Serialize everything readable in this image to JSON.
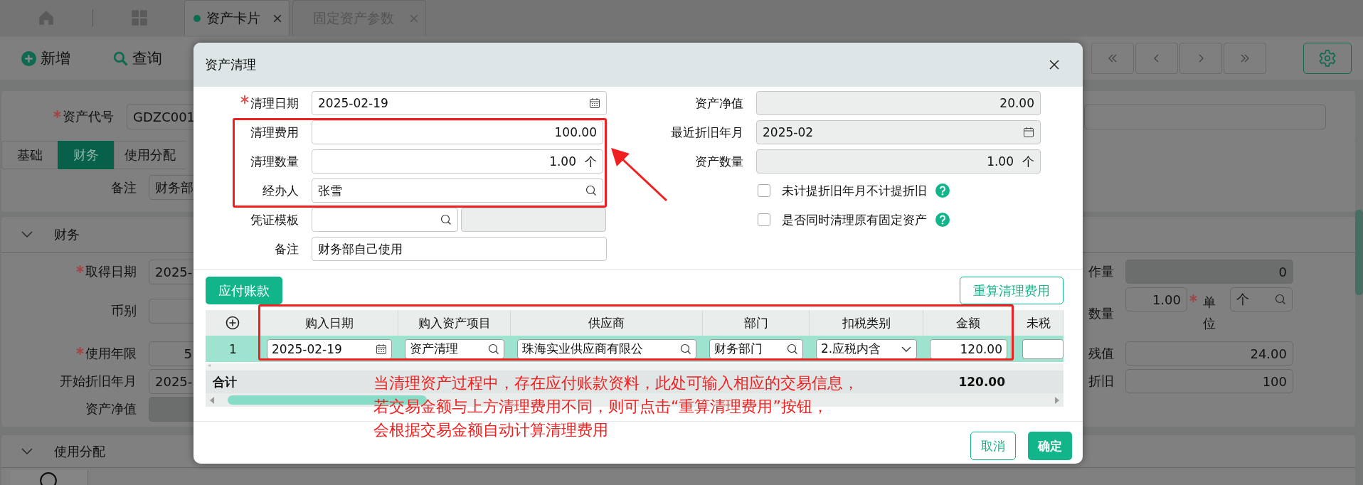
{
  "top_tabs": {
    "items": [
      {
        "label": "资产卡片",
        "selected": true
      },
      {
        "label": "固定资产参数",
        "selected": false
      }
    ]
  },
  "toolbar": {
    "buttons": [
      {
        "kind": "add",
        "label": "新增"
      },
      {
        "kind": "search",
        "label": "查询"
      }
    ]
  },
  "card": {
    "asset_code": {
      "label": "资产代号",
      "required": true,
      "value": "GDZC001"
    },
    "tabs": [
      {
        "label": "基础",
        "selected": false
      },
      {
        "label": "财务",
        "selected": true
      },
      {
        "label": "使用分配",
        "selected": false
      }
    ],
    "remark": {
      "label": "备注",
      "value": "财务部"
    },
    "sections": [
      {
        "title": "财务",
        "expanded": true
      },
      {
        "title": "使用分配",
        "expanded": true
      }
    ],
    "finance_left": [
      {
        "label": "取得日期",
        "required": true,
        "value": "2025-"
      },
      {
        "label": "币别"
      },
      {
        "label": "使用年限",
        "required": true,
        "value": "5"
      },
      {
        "label": "开始折旧年月",
        "value": "2025-"
      },
      {
        "label": "资产净值",
        "disabled": true
      }
    ],
    "finance_right": [
      {
        "label": "作量",
        "value": "0",
        "disabled": true
      },
      {
        "label": "数量",
        "value": "1.00",
        "unit_label": "单位",
        "unit_required": true,
        "unit_value": "个"
      },
      {
        "label": "残值",
        "value": "24.00"
      },
      {
        "label": "折旧",
        "value": "100"
      }
    ]
  },
  "dialog": {
    "title": "资产清理",
    "left_fields": [
      {
        "label": "清理日期",
        "required": true,
        "kind": "date",
        "value": "2025-02-19"
      },
      {
        "label": "清理费用",
        "kind": "number",
        "value": "100.00"
      },
      {
        "label": "清理数量",
        "kind": "number",
        "value": "1.00",
        "unit": "个"
      },
      {
        "label": "经办人",
        "kind": "lookup",
        "value": "张雪"
      },
      {
        "label": "凭证模板",
        "kind": "lookup_pair"
      },
      {
        "label": "备注",
        "kind": "text",
        "value": "财务部自己使用"
      }
    ],
    "right_fields": [
      {
        "label": "资产净值",
        "kind": "number",
        "value": "20.00",
        "disabled": true
      },
      {
        "label": "最近折旧年月",
        "kind": "month",
        "value": "2025-02",
        "disabled": true
      },
      {
        "label": "资产数量",
        "kind": "number",
        "value": "1.00",
        "unit": "个",
        "disabled": true
      }
    ],
    "checkboxes": [
      {
        "label": "未计提折旧年月不计提折旧",
        "checked": false
      },
      {
        "label": "是否同时清理原有固定资产",
        "checked": false
      }
    ],
    "payable_button": "应付账款",
    "recalc_button": "重算清理费用",
    "grid": {
      "columns": [
        "购入日期",
        "购入资产项目",
        "供应商",
        "部门",
        "扣税类别",
        "金额",
        "未税"
      ],
      "rows": [
        {
          "index": "1",
          "selected": true,
          "cells": [
            {
              "kind": "date",
              "value": "2025-02-19"
            },
            {
              "kind": "lookup",
              "value": "资产清理"
            },
            {
              "kind": "lookup",
              "value": "珠海实业供应商有限公"
            },
            {
              "kind": "lookup",
              "value": "财务部门"
            },
            {
              "kind": "select",
              "value": "2.应税内含"
            },
            {
              "kind": "number",
              "value": "120.00"
            },
            {
              "kind": "blank"
            }
          ]
        }
      ],
      "total_label": "合计",
      "total_amount": "120.00"
    },
    "note": [
      "当清理资产过程中，存在应付账款资料，此处可输入相应的交易信息，",
      "若交易金额与上方清理费用不同，则可点击“重算清理费用”按钮，",
      "会根据交易金额自动计算清理费用"
    ],
    "buttons": [
      {
        "kind": "cancel",
        "label": "取消"
      },
      {
        "kind": "confirm",
        "label": "确定"
      }
    ]
  }
}
